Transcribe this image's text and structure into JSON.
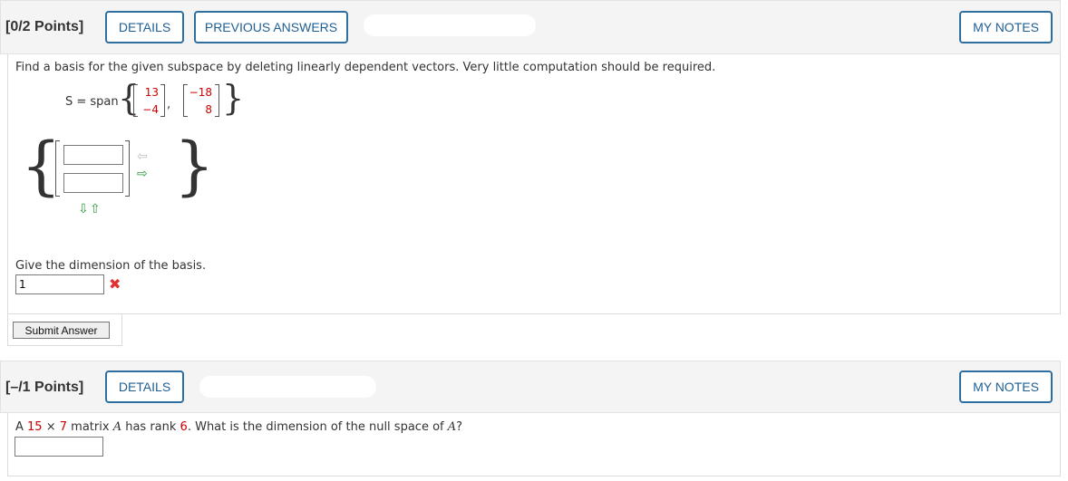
{
  "question1": {
    "points": "[0/2 Points]",
    "buttons": {
      "details": "DETAILS",
      "previous_answers": "PREVIOUS ANSWERS",
      "my_notes": "MY NOTES"
    },
    "prompt": "Find a basis for the given subspace by deleting linearly dependent vectors. Very little computation should be required.",
    "span_label": "S = span",
    "vectors": [
      {
        "top": "13",
        "bottom": "−4"
      },
      {
        "top": "−18",
        "bottom": "8"
      }
    ],
    "vector_separator": ",",
    "basis_entries": [
      "",
      ""
    ],
    "arrows": {
      "remove_vector": "⇦",
      "add_vector": "⇨",
      "remove_row": "⇩",
      "add_row": "⇧"
    },
    "dimension_prompt": "Give the dimension of the basis.",
    "dimension_value": "1",
    "dimension_status": "incorrect",
    "incorrect_icon": "✖",
    "submit_label": "Submit Answer"
  },
  "question2": {
    "points": "[–/1 Points]",
    "buttons": {
      "details": "DETAILS",
      "my_notes": "MY NOTES"
    },
    "prompt": {
      "p1": "A ",
      "rows": "15",
      "times": " × ",
      "cols": "7",
      "p2": " matrix ",
      "var_a": "A",
      "p3": " has rank ",
      "rank": "6",
      "p4": ". What is the dimension of the null space of ",
      "var_a2": "A",
      "p5": "?"
    },
    "answer_value": ""
  },
  "colors": {
    "button_border": "#2e6fa0",
    "button_text": "#1f5f92",
    "header_bg": "#f4f4f4",
    "value_red": "#cc0000",
    "wrong_red": "#e03030",
    "arrow_green": "#2e9a3a",
    "arrow_gray": "#c0c0c0"
  }
}
